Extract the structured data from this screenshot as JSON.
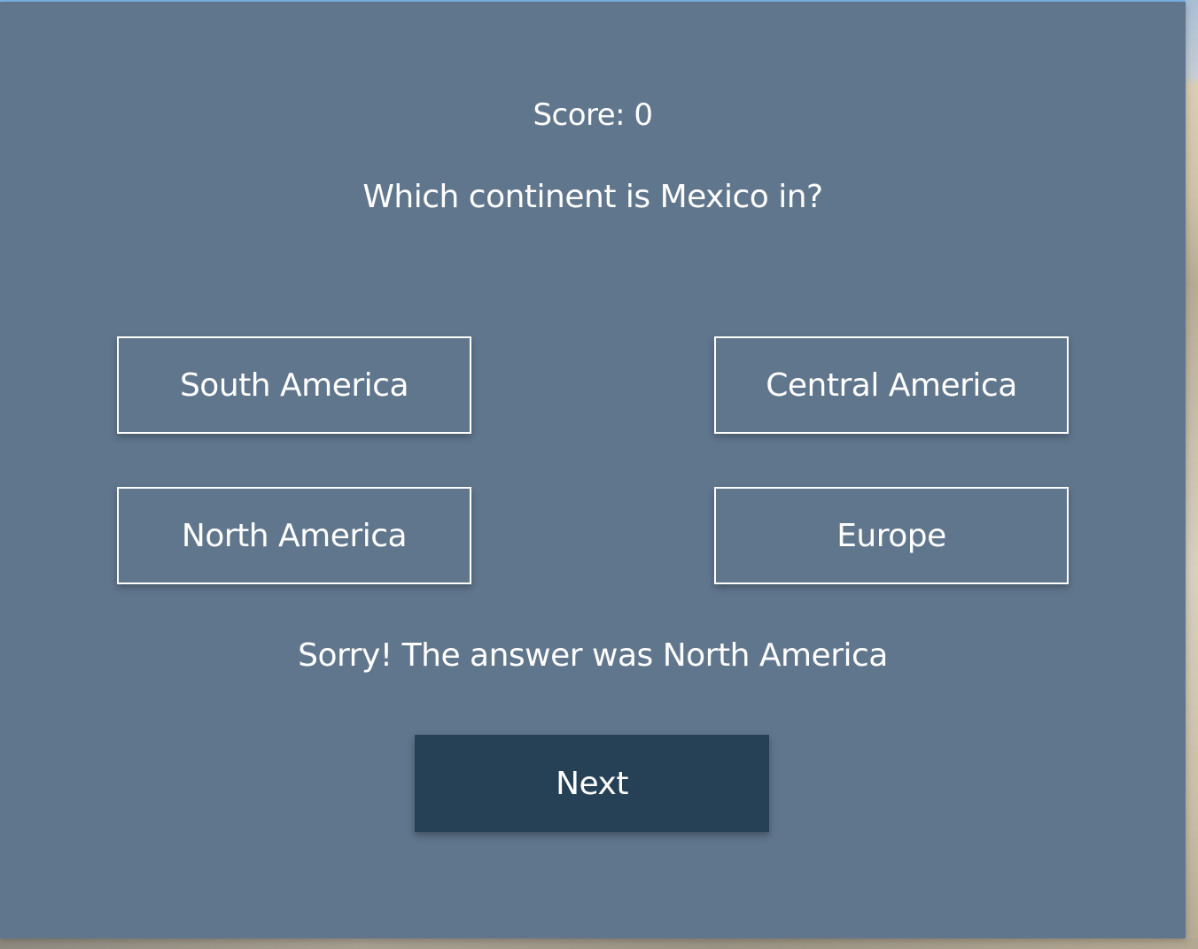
{
  "quiz": {
    "score_text": "Score: 0",
    "question": "Which continent is Mexico in?",
    "answers": [
      {
        "label": "South America"
      },
      {
        "label": "Central America"
      },
      {
        "label": "North America"
      },
      {
        "label": "Europe"
      }
    ],
    "feedback": "Sorry! The answer was North America",
    "next_label": "Next"
  },
  "colors": {
    "panel_background": "#60768d",
    "next_button_background": "#264155",
    "text": "#ffffff",
    "answer_border": "#ffffff"
  }
}
